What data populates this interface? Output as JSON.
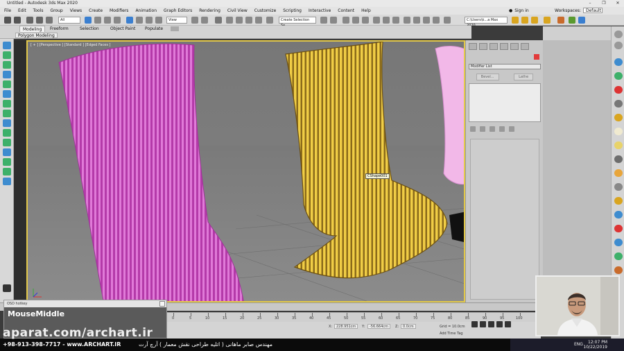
{
  "window": {
    "title": "Untitled - Autodesk 3ds Max 2020",
    "controls": [
      "–",
      "❐",
      "✕"
    ]
  },
  "menu": {
    "items": [
      "File",
      "Edit",
      "Tools",
      "Group",
      "Views",
      "Create",
      "Modifiers",
      "Animation",
      "Graph Editors",
      "Rendering",
      "Civil View",
      "Customize",
      "Scripting",
      "Interactive",
      "Content",
      "Help"
    ],
    "sign_in": "Sign in",
    "workspaces_label": "Workspaces:",
    "workspace_value": "Default"
  },
  "toolbar": {
    "selection_filter": "All",
    "view_dropdown": "View",
    "create_selection_set": "Create Selection Se",
    "path_field": "C:\\Users\\k...a Max 2020"
  },
  "ribbon": {
    "tabs": [
      "Modeling",
      "Freeform",
      "Selection",
      "Object Paint",
      "Populate"
    ],
    "active_tab": "Modeling",
    "subpanel": "Polygon Modeling"
  },
  "viewport": {
    "label": "[ + ] [Perspective ] [Standard ] [Edged Faces ]",
    "object_tooltip": "CShape001",
    "colors": {
      "pink_chair": "#c94fc1",
      "yellow_chair": "#e8c13a",
      "border": "#e2c84a"
    }
  },
  "command_panel": {
    "modifier_list": "Modifier List",
    "buttons": [
      "Bevel...",
      "Lathe"
    ]
  },
  "timeline": {
    "ticks": [
      "0",
      "5",
      "10",
      "15",
      "20",
      "25",
      "30",
      "35",
      "40",
      "45",
      "50",
      "55",
      "60",
      "65",
      "70",
      "75",
      "80",
      "85",
      "90",
      "95",
      "100"
    ]
  },
  "status": {
    "x_label": "X:",
    "x_value": "228.951cm",
    "y_label": "Y:",
    "y_value": "-56.664cm",
    "z_label": "Z:",
    "z_value": "0.0cm",
    "grid": "Grid = 10.0cm",
    "add_time_tag": "Add Time Tag"
  },
  "hotkey_overlay": {
    "title": "OSD hotkey",
    "key": "MouseMiddle"
  },
  "watermark": "aparat.com/archart.ir",
  "banner": {
    "phone": "+98-913-398-7717  -  www.ARCHART.IR",
    "persian": "مهندس صابر ماهانی ( اتلیه طراحی نقش معمار ) آرچ آرت"
  },
  "taskbar": {
    "lang": "ENG",
    "time": "12:07 PM",
    "date": "10/22/2019"
  }
}
